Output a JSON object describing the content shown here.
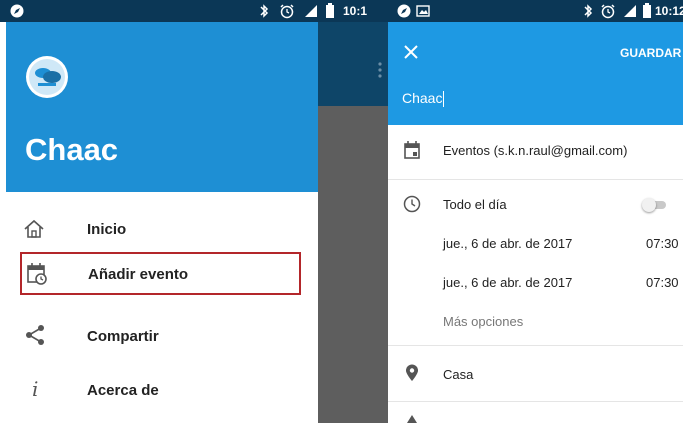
{
  "left": {
    "status_time": "10:1",
    "app_name": "Chaac",
    "menu": [
      {
        "label": "Inicio",
        "icon": "home-icon"
      },
      {
        "label": "Añadir evento",
        "icon": "calendar-clock-icon"
      },
      {
        "label": "Compartir",
        "icon": "share-icon"
      },
      {
        "label": "Acerca de",
        "icon": "info-icon"
      }
    ],
    "highlight_color": "#b3262a",
    "header_color": "#1e8fd4"
  },
  "right": {
    "status_time": "10:12",
    "close_icon": "close-icon",
    "save_label": "GUARDAR",
    "title_value": "Chaac",
    "calendar_account": "Eventos (s.k.n.raul@gmail.com)",
    "all_day_label": "Todo el día",
    "all_day_on": false,
    "start_date": "jue., 6 de abr. de 2017",
    "start_time": "07:30",
    "end_date": "jue., 6 de abr. de 2017",
    "end_time": "07:30",
    "more_options": "Más opciones",
    "location": "Casa",
    "appbar_color": "#1e99e3"
  }
}
